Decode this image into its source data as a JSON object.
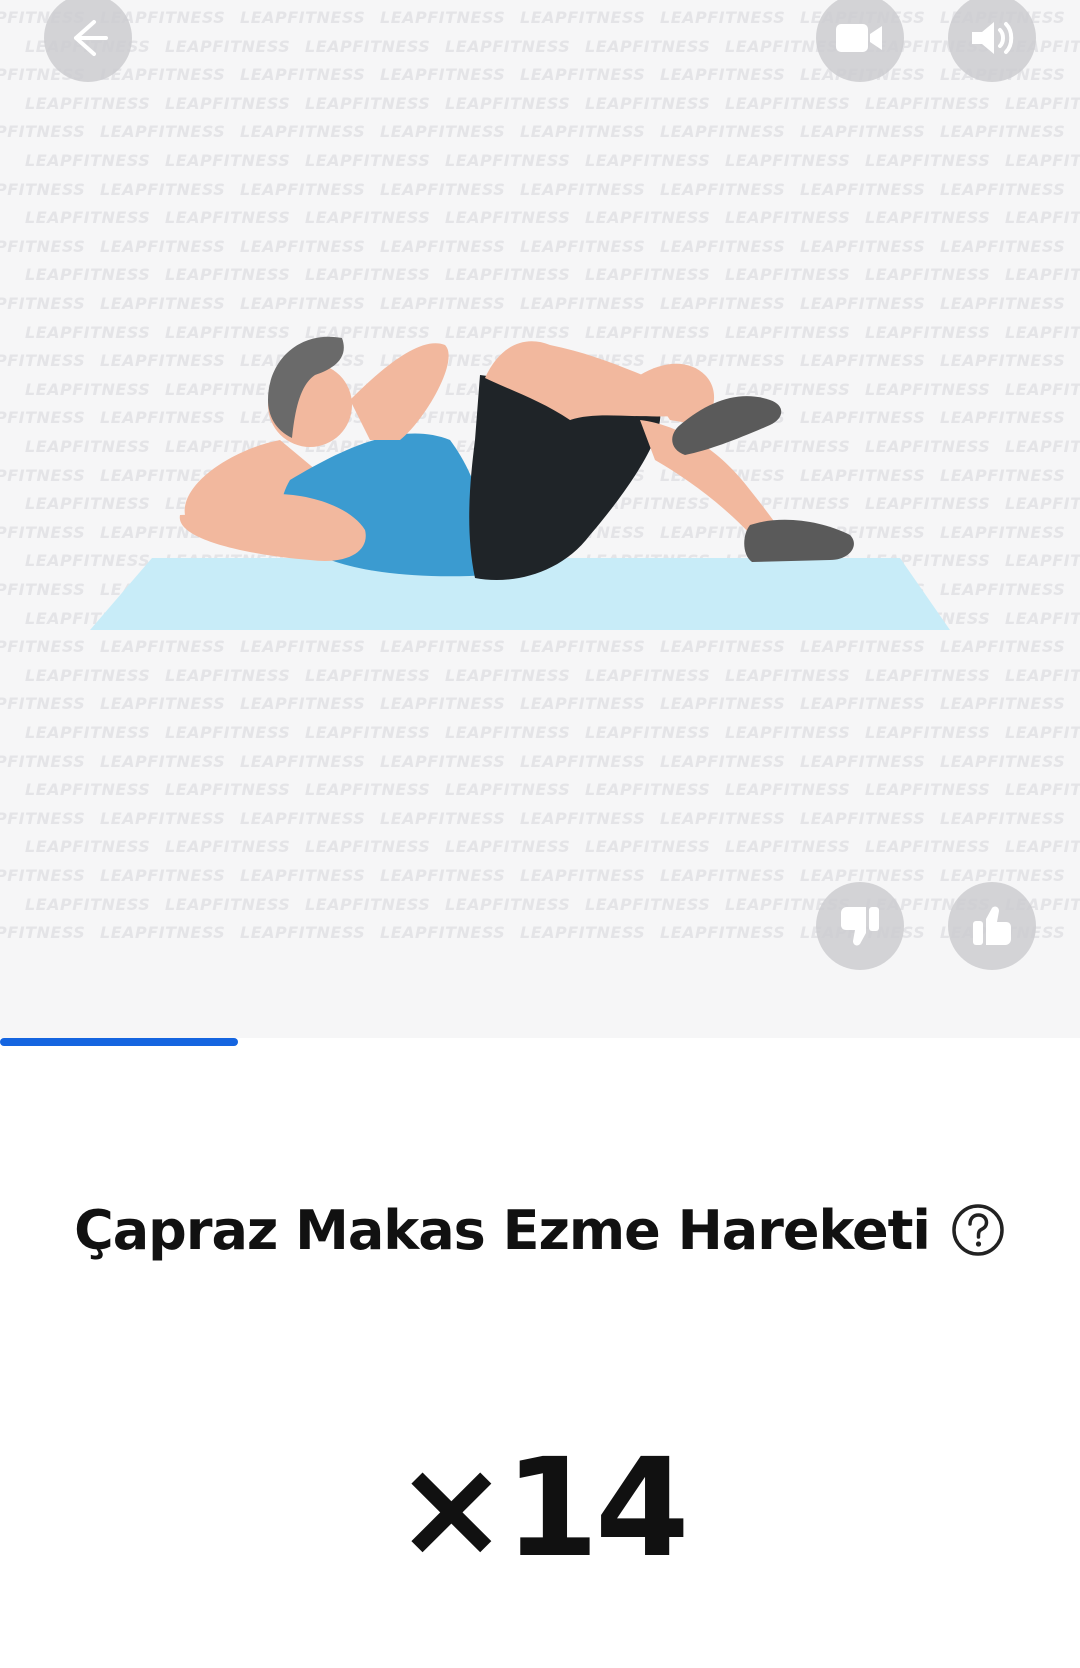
{
  "watermark": {
    "text": "LEAPFITNESS"
  },
  "header": {
    "back_icon": "arrow-left-icon",
    "video_icon": "video-camera-icon",
    "sound_icon": "speaker-volume-icon"
  },
  "feedback": {
    "dislike_icon": "thumbs-down-icon",
    "like_icon": "thumbs-up-icon"
  },
  "progress": {
    "fraction": 0.22,
    "color": "#1565e0"
  },
  "exercise": {
    "title": "Çapraz Makas Ezme Hareketi",
    "help_icon": "question-circle-icon",
    "reps": "×14"
  },
  "colors": {
    "mat": "#c8ecf8",
    "shirt": "#3b9bd0",
    "shorts": "#1f2428",
    "skin": "#f2b89e",
    "hair": "#6a6a6a",
    "shoe": "#5a5a5a"
  }
}
